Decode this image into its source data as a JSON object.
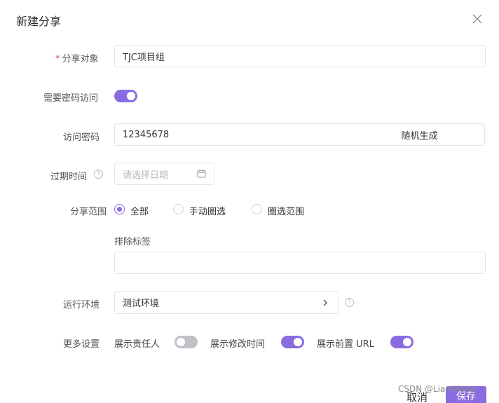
{
  "dialog": {
    "title": "新建分享",
    "close_icon": "close-icon"
  },
  "form": {
    "share_target": {
      "required_mark": "*",
      "label": "分享对象",
      "value": "TJC项目组"
    },
    "require_password": {
      "label": "需要密码访问",
      "checked": true
    },
    "password": {
      "label": "访问密码",
      "value": "12345678",
      "generate_button": "随机生成"
    },
    "expire": {
      "label": "过期时间",
      "help_icon": "question-circle-icon",
      "placeholder": "请选择日期",
      "calendar_icon": "calendar-icon"
    },
    "share_scope": {
      "label": "分享范围",
      "options": [
        {
          "label": "全部",
          "checked": true
        },
        {
          "label": "手动圈选",
          "checked": false
        },
        {
          "label": "圈选范围",
          "checked": false
        }
      ]
    },
    "exclude_tags": {
      "label": "排除标签",
      "value": ""
    },
    "environment": {
      "label": "运行环境",
      "value": "测试环境",
      "chevron_icon": "chevron-right-icon",
      "help_icon": "question-circle-icon"
    },
    "more_settings": {
      "label": "更多设置",
      "items": [
        {
          "label": "展示责任人",
          "checked": false
        },
        {
          "label": "展示修改时间",
          "checked": true
        },
        {
          "label": "展示前置 URL",
          "checked": true
        }
      ]
    }
  },
  "footer": {
    "cancel_label": "取消",
    "save_label": "保存"
  },
  "watermark": "CSDN @LiamHong",
  "colors": {
    "accent": "#8a6ce0",
    "required": "#e5484d",
    "switch_off": "#bfc1c6"
  }
}
